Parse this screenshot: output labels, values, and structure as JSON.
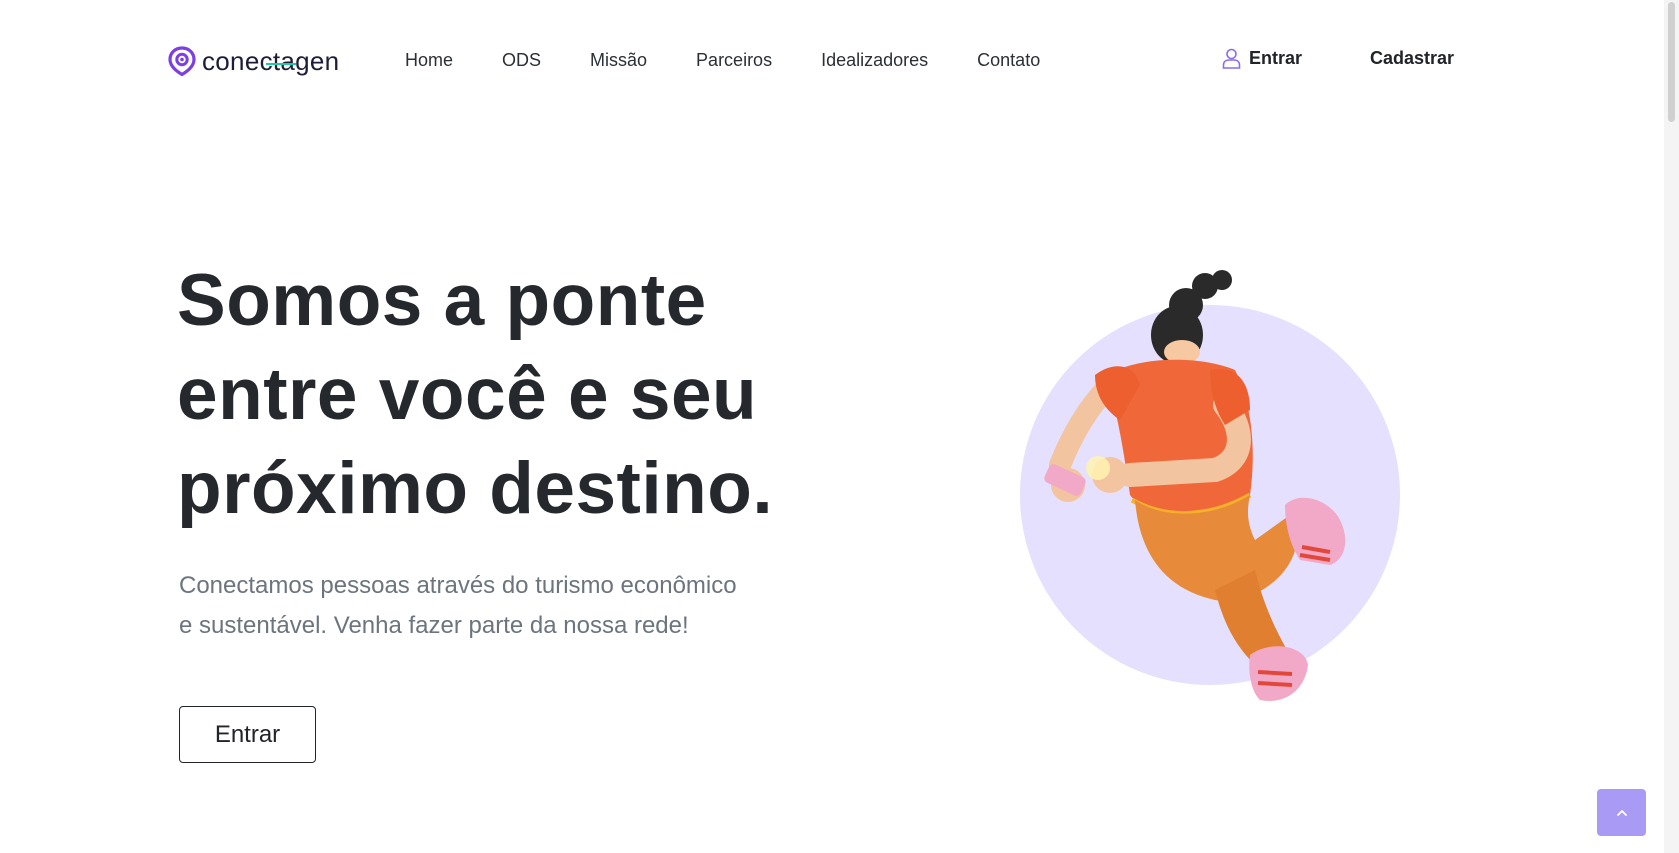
{
  "brand": {
    "name": "conectagen",
    "accent": "#7b3fe4",
    "line_color": "#22c7a9"
  },
  "nav": {
    "items": [
      "Home",
      "ODS",
      "Missão",
      "Parceiros",
      "Idealizadores",
      "Contato"
    ],
    "login_label": "Entrar",
    "signup_label": "Cadastrar"
  },
  "hero": {
    "title_lines": [
      "Somos a ponte",
      "entre você e seu",
      "próximo destino."
    ],
    "subtitle_lines": [
      "Conectamos pessoas através do turismo econômico",
      "e sustentável. Venha fazer parte da nossa rede!"
    ],
    "cta_label": "Entrar"
  },
  "icons": {
    "login": "user-icon",
    "back_to_top": "chevron-up-icon"
  },
  "colors": {
    "circle": "#e5e0fd",
    "shirt": "#f0683a",
    "pants": "#e78a3a",
    "shoes": "#f2a9c7",
    "to_top": "#a99bf5"
  }
}
